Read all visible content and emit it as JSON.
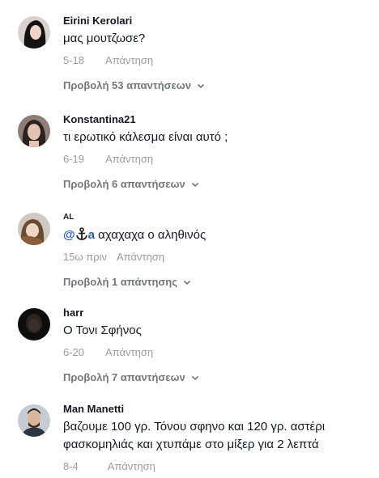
{
  "comments": [
    {
      "username": "Eirini Kerolari",
      "text": "μας μουτζωσε?",
      "time": "5-18",
      "reply_label": "Απάντηση",
      "view_replies": "Προβολή 53 απαντήσεων"
    },
    {
      "username": "Konstantina21",
      "text": "τι ερωτικό κάλεσμα είναι αυτό ;",
      "time": "6-19",
      "reply_label": "Απάντηση",
      "view_replies": "Προβολή 6 απαντήσεων"
    },
    {
      "username": "AL",
      "mention": "@",
      "mention_tail": "a",
      "text": " αχαχαχα ο αληθινός",
      "time": "15ω πριν",
      "reply_label": "Απάντηση",
      "view_replies": "Προβολή 1 απάντησης"
    },
    {
      "username": "harr",
      "text": "Ο Τονι Σφήνος",
      "time": "6-20",
      "reply_label": "Απάντηση",
      "view_replies": "Προβολή 7 απαντήσεων"
    },
    {
      "username": "Man Manetti",
      "text": "βαζουμε 100 γρ. Τόνου σφηνο και 120 γρ. αστέρι φασκομηλιάς και χτυπάμε στο μίξερ για 2 λεπτά",
      "time": "8-4",
      "reply_label": "Απάντηση"
    }
  ],
  "icons": {
    "chevron": "chevron-down-icon",
    "anchor": "anchor-icon"
  },
  "colors": {
    "mention": "#2b5db9",
    "meta": "#9b9ca2",
    "view_replies": "#75767c"
  }
}
